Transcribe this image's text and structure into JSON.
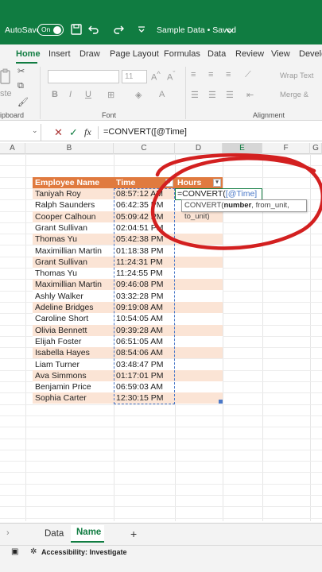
{
  "titlebar": {
    "autosave_label": "AutoSave",
    "autosave_state": "On",
    "document_title": "Sample Data • Saved"
  },
  "ribbon": {
    "tabs": [
      "Home",
      "Insert",
      "Draw",
      "Page Layout",
      "Formulas",
      "Data",
      "Review",
      "View",
      "Develo"
    ],
    "groups": {
      "clipboard_label": "ipboard",
      "font_label": "Font",
      "alignment_label": "Alignment",
      "font_size_value": "11",
      "wrap_text": "Wrap Text",
      "merge": "Merge &",
      "paste_fragment": "ste"
    }
  },
  "formula_bar": {
    "formula": "=CONVERT([@Time]"
  },
  "columns": [
    "A",
    "B",
    "C",
    "D",
    "E",
    "F",
    "G"
  ],
  "table": {
    "headers": [
      "Employee Name",
      "Time",
      "Hours"
    ],
    "rows": [
      {
        "name": "Taniyah Roy",
        "time": "08:57:12 AM"
      },
      {
        "name": "Ralph Saunders",
        "time": "06:42:35 PM"
      },
      {
        "name": "Cooper Calhoun",
        "time": "05:09:42 PM"
      },
      {
        "name": "Grant Sullivan",
        "time": "02:04:51 PM"
      },
      {
        "name": "Thomas Yu",
        "time": "05:42:38 PM"
      },
      {
        "name": "Maximillian Martin",
        "time": "01:18:38 PM"
      },
      {
        "name": "Grant Sullivan",
        "time": "11:24:31 PM"
      },
      {
        "name": "Thomas Yu",
        "time": "11:24:55 PM"
      },
      {
        "name": "Maximillian Martin",
        "time": "09:46:08 PM"
      },
      {
        "name": "Ashly Walker",
        "time": "03:32:28 PM"
      },
      {
        "name": "Adeline Bridges",
        "time": "09:19:08 AM"
      },
      {
        "name": "Caroline Short",
        "time": "10:54:05 AM"
      },
      {
        "name": "Olivia Bennett",
        "time": "09:39:28 AM"
      },
      {
        "name": "Elijah Foster",
        "time": "06:51:05 AM"
      },
      {
        "name": "Isabella Hayes",
        "time": "08:54:06 AM"
      },
      {
        "name": "Liam Turner",
        "time": "03:48:47 PM"
      },
      {
        "name": "Ava Simmons",
        "time": "01:17:01 PM"
      },
      {
        "name": "Benjamin Price",
        "time": "06:59:03 AM"
      },
      {
        "name": "Sophia Carter",
        "time": "12:30:15 PM"
      }
    ]
  },
  "editing_cell": {
    "formula_prefix": "=CONVERT(",
    "formula_ref": "[@Time]"
  },
  "tooltip": {
    "fn": "CONVERT(",
    "arg1": "number",
    "rest": ", from_unit, to_unit)"
  },
  "sheets": [
    "Data",
    "Name"
  ],
  "add_sheet": "+",
  "status": {
    "accessibility": "Accessibility: Investigate"
  },
  "colors": {
    "brand": "#107c41",
    "table_header": "#e07a3f",
    "table_band": "#fbe4d5",
    "annotation": "#d32020"
  }
}
